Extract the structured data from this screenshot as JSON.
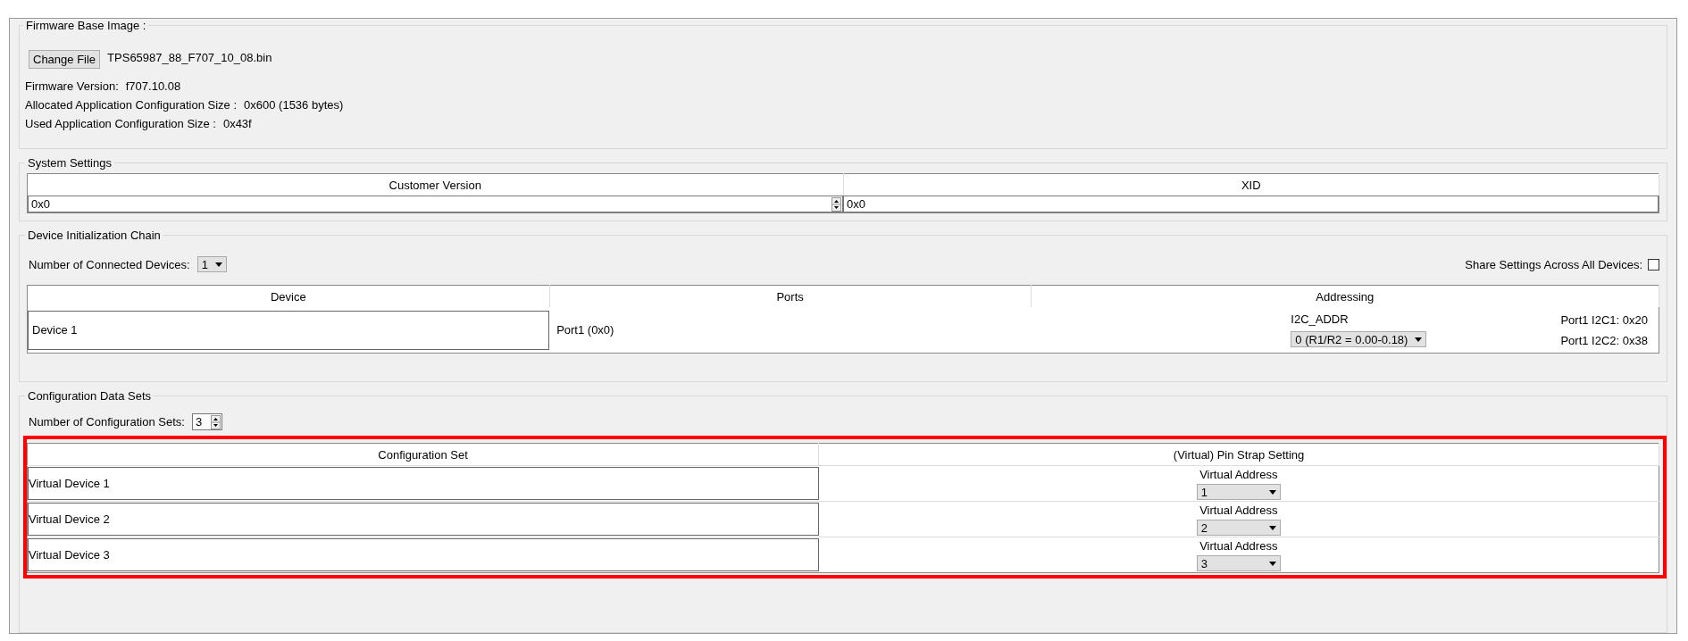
{
  "firmware": {
    "legend": "Firmware Base Image :",
    "change_button": "Change File",
    "file_name": "TPS65987_88_F707_10_08.bin",
    "info": [
      {
        "label": "Firmware Version:",
        "value": "f707.10.08"
      },
      {
        "label": "Allocated Application Configuration Size :",
        "value": "0x600 (1536 bytes)"
      },
      {
        "label": "Used Application Configuration Size :",
        "value": "0x43f"
      }
    ]
  },
  "system_settings": {
    "legend": "System Settings",
    "columns": [
      {
        "header": "Customer Version",
        "value": "0x0",
        "kind": "spinner"
      },
      {
        "header": "XID",
        "value": "0x0",
        "kind": "text"
      }
    ]
  },
  "device_chain": {
    "legend": "Device Initialization Chain",
    "count_label": "Number of Connected Devices:",
    "count_value": "1",
    "share_label": "Share Settings Across All Devices:",
    "share_checked": false,
    "columns": [
      "Device",
      "Ports",
      "Addressing"
    ],
    "rows": [
      {
        "device": "Device 1",
        "ports": "Port1 (0x0)",
        "addr_label": "I2C_ADDR",
        "addr_value": "0 (R1/R2 = 0.00-0.18)",
        "i2c": [
          "Port1 I2C1: 0x20",
          "Port1 I2C2: 0x38"
        ]
      }
    ]
  },
  "config_sets": {
    "legend": "Configuration Data Sets",
    "count_label": "Number of Configuration Sets:",
    "count_value": "3",
    "columns": [
      "Configuration Set",
      "(Virtual) Pin Strap Setting"
    ],
    "rows": [
      {
        "name": "Virtual Device 1",
        "address_label": "Virtual Address",
        "address_value": "1"
      },
      {
        "name": "Virtual Device 2",
        "address_label": "Virtual Address",
        "address_value": "2"
      },
      {
        "name": "Virtual Device 3",
        "address_label": "Virtual Address",
        "address_value": "3"
      }
    ]
  }
}
